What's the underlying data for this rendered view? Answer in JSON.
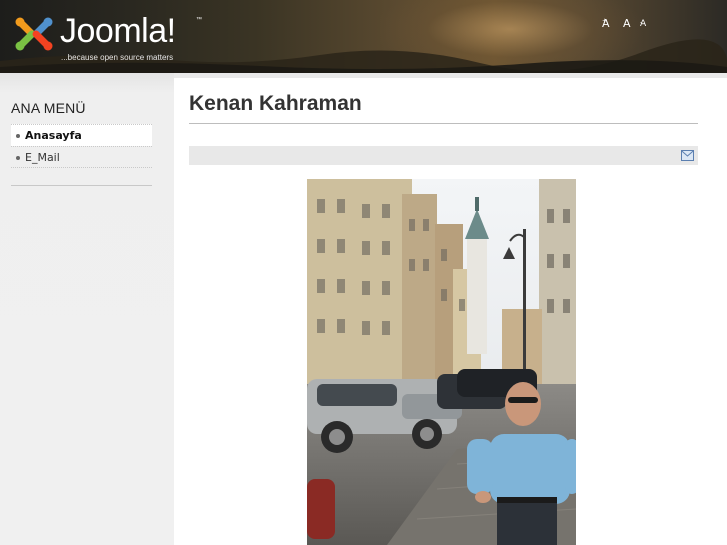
{
  "header": {
    "logo_text": "Joomla!",
    "logo_tm": "™",
    "tagline": "...because open source matters",
    "font_controls": {
      "increase": "A",
      "increase_mark": "+",
      "reset": "A",
      "decrease": "A",
      "decrease_mark": "-"
    }
  },
  "sidebar": {
    "menu_title": "ANA MENÜ",
    "items": [
      {
        "label": "Anasayfa",
        "active": true
      },
      {
        "label": "E_Mail",
        "active": false
      }
    ]
  },
  "article": {
    "title": "Kenan Kahraman",
    "email_icon": "envelope-icon",
    "image": "photo of a man standing on a cobblestone street with parked cars and buildings"
  },
  "colors": {
    "header_dark": "#1d1d1b",
    "sidebar_bg": "#f0f0f0",
    "icon_bar_bg": "#e8e8e8",
    "title_color": "#333333"
  }
}
